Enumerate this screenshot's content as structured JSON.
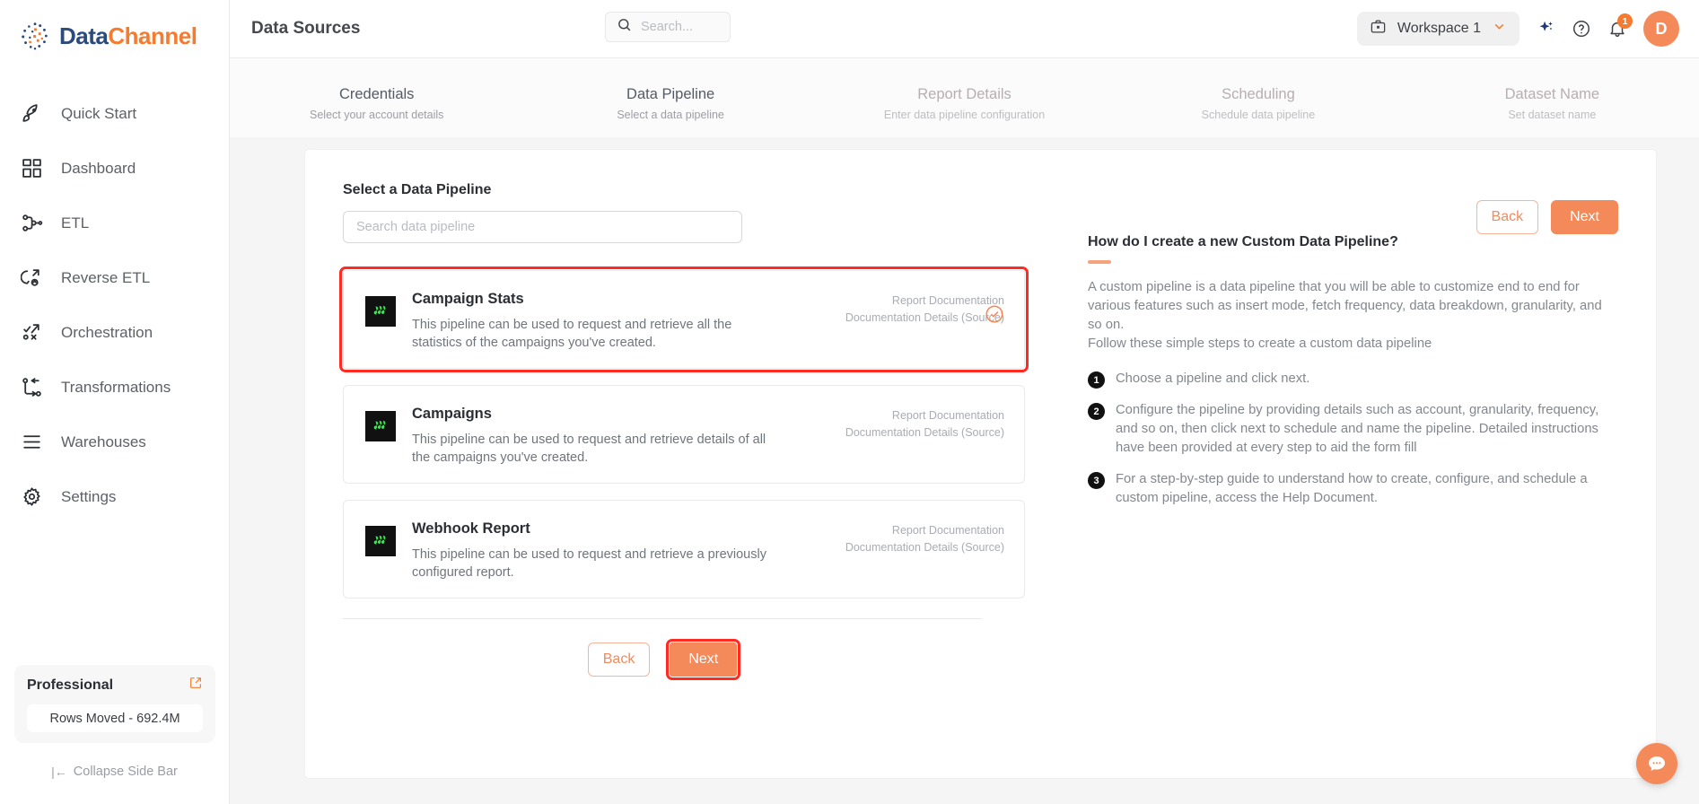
{
  "brand": {
    "name_part1": "Data",
    "name_part2": "Channel"
  },
  "sidebar": {
    "items": [
      {
        "label": "Quick Start",
        "icon": "rocket-icon"
      },
      {
        "label": "Dashboard",
        "icon": "grid-icon"
      },
      {
        "label": "ETL",
        "icon": "etl-icon"
      },
      {
        "label": "Reverse ETL",
        "icon": "reverse-etl-icon"
      },
      {
        "label": "Orchestration",
        "icon": "orchestration-icon"
      },
      {
        "label": "Transformations",
        "icon": "transformations-icon"
      },
      {
        "label": "Warehouses",
        "icon": "warehouses-icon"
      },
      {
        "label": "Settings",
        "icon": "gear-icon"
      }
    ],
    "plan": {
      "name": "Professional",
      "rows_moved": "Rows Moved - 692.4M"
    },
    "collapse": {
      "arrow": "|←",
      "label": "Collapse Side Bar"
    }
  },
  "header": {
    "title": "Data Sources",
    "search_placeholder": "Search...",
    "search_value": "",
    "workspace": "Workspace 1",
    "notification_count": "1",
    "avatar_initial": "D"
  },
  "stepper": {
    "steps": [
      {
        "label": "Credentials",
        "sub": "Select your account details",
        "state": "done"
      },
      {
        "label": "Data Pipeline",
        "sub": "Select a data pipeline",
        "state": "active"
      },
      {
        "label": "Report Details",
        "sub": "Enter data pipeline configuration",
        "state": "inactive"
      },
      {
        "label": "Scheduling",
        "sub": "Schedule data pipeline",
        "state": "inactive"
      },
      {
        "label": "Dataset Name",
        "sub": "Set dataset name",
        "state": "inactive"
      }
    ]
  },
  "main": {
    "section_title": "Select a Data Pipeline",
    "pipeline_search_placeholder": "Search data pipeline",
    "pipeline_search_value": "",
    "back_label": "Back",
    "next_label": "Next",
    "pipelines": [
      {
        "title": "Campaign Stats",
        "description": "This pipeline can be used to request and retrieve all the statistics of the campaigns you've created.",
        "doc_link_1": "Report Documentation",
        "doc_link_2": "Documentation Details (Source)",
        "selected": true
      },
      {
        "title": "Campaigns",
        "description": "This pipeline can be used to request and retrieve details of all the campaigns you've created.",
        "doc_link_1": "Report Documentation",
        "doc_link_2": "Documentation Details (Source)",
        "selected": false
      },
      {
        "title": "Webhook Report",
        "description": "This pipeline can be used to request and retrieve a previously configured report.",
        "doc_link_1": "Report Documentation",
        "doc_link_2": "Documentation Details (Source)",
        "selected": false
      }
    ]
  },
  "help": {
    "title": "How do I create a new Custom Data Pipeline?",
    "paragraph": "A custom pipeline is a data pipeline that you will be able to customize end to end for various features such as insert mode, fetch frequency, data breakdown, granularity, and so on.\nFollow these simple steps to create a custom data pipeline",
    "steps": [
      {
        "num": "1",
        "text": "Choose a pipeline and click next."
      },
      {
        "num": "2",
        "text": "Configure the pipeline by providing details such as account, granularity, frequency, and so on, then click next to schedule and name the pipeline. Detailed instructions have been provided at every step to aid the form fill"
      },
      {
        "num": "3",
        "text": "For a step-by-step guide to understand how to create, configure, and schedule a custom pipeline, access the Help Document."
      }
    ]
  },
  "colors": {
    "accent": "#f4895a",
    "brand_navy": "#2b4a7d",
    "brand_orange": "#f47b30",
    "annotation_red": "#ff2a21",
    "pipeline_icon_green": "#2bed4c"
  }
}
